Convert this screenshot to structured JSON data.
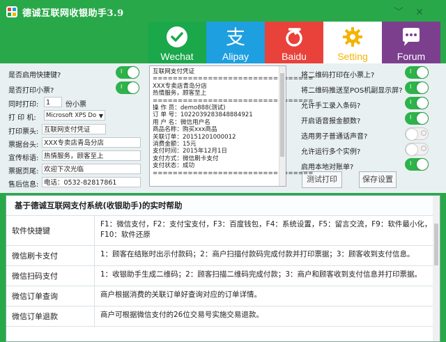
{
  "window": {
    "title": "德诚互联网收银助手3.9",
    "minimize_glyph": "﹀",
    "close_glyph": "✕"
  },
  "tabs": [
    {
      "label": "Wechat",
      "icon": "wechat-icon",
      "color": "#1aa84a"
    },
    {
      "label": "Alipay",
      "icon": "alipay-icon",
      "color": "#1e9fe0"
    },
    {
      "label": "Baidu",
      "icon": "baidu-icon",
      "color": "#e8423a"
    },
    {
      "label": "Setting",
      "icon": "gear-icon",
      "color": "#ffffff",
      "active": true
    },
    {
      "label": "Forum",
      "icon": "chat-bubble-icon",
      "color": "#7b3f8e"
    }
  ],
  "left": {
    "quick_key_label": "是否启用快捷键?",
    "quick_key_on": true,
    "print_ticket_label": "是否打印小票?",
    "print_ticket_on": true,
    "copies_label": "同时打印:",
    "copies_value": "1",
    "copies_unit": "份小票",
    "printer_label": "打 印 机:",
    "printer_value": "Microsoft XPS Do",
    "header_label": "打印票头:",
    "header_value": "互联网支付凭证",
    "shop_label": "票据台头:",
    "shop_value": "XXX专卖店青岛分店",
    "slogan_label": "宣传标语:",
    "slogan_value": "热情服务，顾客至上",
    "footer_label": "票据页尾:",
    "footer_value": "欢迎下次光临",
    "aftersale_label": "售后信息:",
    "aftersale_value": "电话：0532-82817861"
  },
  "receipt": {
    "lines": [
      "互联网支付凭证",
      "================================",
      "XXX专卖店青岛分店",
      "热情服务，顾客至上",
      "================================",
      "操 作 员：demo888(测试)",
      "订 单 号：1022039283848884921",
      "用 户 名：微信用户名",
      "商品名称：购买xxx商品",
      "关联订单：20151201000012",
      "消费金额：15元",
      "支付时间：2015年12月1日",
      "支付方式：微信刷卡支付",
      "支付状态：成功",
      "================================"
    ]
  },
  "right": {
    "options": [
      {
        "label": "将二维码打印在小票上?",
        "on": true
      },
      {
        "label": "将二维码推送至POS机副显示屏?",
        "on": true
      },
      {
        "label": "允许手工录入条码?",
        "on": true
      },
      {
        "label": "开启语音报金额数?",
        "on": true
      },
      {
        "label": "选用男子普通话声音?",
        "on": false
      },
      {
        "label": "允许运行多个实例?",
        "on": false
      },
      {
        "label": "启用本地对账单?",
        "on": true
      }
    ],
    "test_print_label": "测试打印",
    "save_label": "保存设置"
  },
  "help": {
    "title": "基于德诚互联网支付系统(收银助手)的实时帮助",
    "rows": [
      {
        "key": "软件快捷键",
        "value": "F1：微信支付，F2：支付宝支付，F3：百度钱包，F4：系统设置，F5：留言交流，F9：软件最小化，F10：软件还原"
      },
      {
        "key": "微信刷卡支付",
        "value": "1：顾客在结账时出示付款码；2：商户扫描付款码完成付款并打印票据；3：顾客收到支付信息。"
      },
      {
        "key": "微信扫码支付",
        "value": "1：收银助手生成二维码；2：顾客扫描二维码完成付款；3：商户和顾客收到支付信息并打印票据。"
      },
      {
        "key": "微信订单查询",
        "value": "商户根据消费的关联订单好查询对应的订单详情。"
      },
      {
        "key": "微信订单退款",
        "value": "商户可根据微信支付的26位交易号实施交易退款。"
      }
    ]
  }
}
